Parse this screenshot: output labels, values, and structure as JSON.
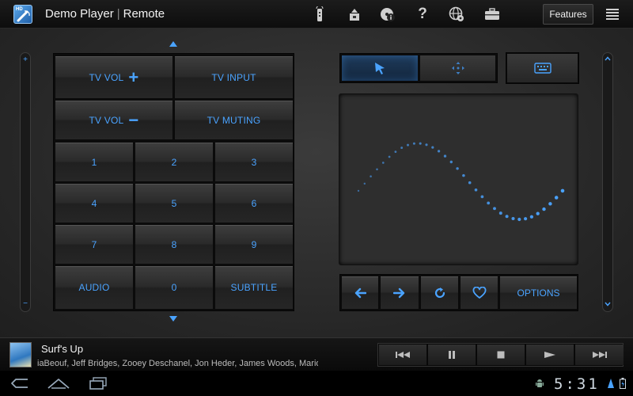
{
  "actionbar": {
    "app_name": "Demo Player",
    "app_section": "Remote",
    "features_label": "Features"
  },
  "keypad": {
    "tv_vol_up": "TV VOL",
    "tv_vol_down": "TV VOL",
    "plus": "+",
    "minus": "−",
    "tv_input": "TV INPUT",
    "tv_muting": "TV MUTING",
    "digits": [
      "1",
      "2",
      "3",
      "4",
      "5",
      "6",
      "7",
      "8",
      "9"
    ],
    "audio": "AUDIO",
    "zero": "0",
    "subtitle": "SUBTITLE"
  },
  "touchpad": {
    "options_label": "OPTIONS"
  },
  "side": {
    "plus": "+",
    "minus": "−",
    "up": "⌃",
    "down": "⌄"
  },
  "nowplaying": {
    "title": "Surf's Up",
    "cast": "iaBeouf, Jeff Bridges, Zooey Deschanel, Jon Heder, James Woods, Mario Cantone"
  },
  "system": {
    "time": "5:31"
  },
  "colors": {
    "accent": "#4aa3ff",
    "background": "#2b2b2b",
    "bar": "#0d0d0d"
  }
}
